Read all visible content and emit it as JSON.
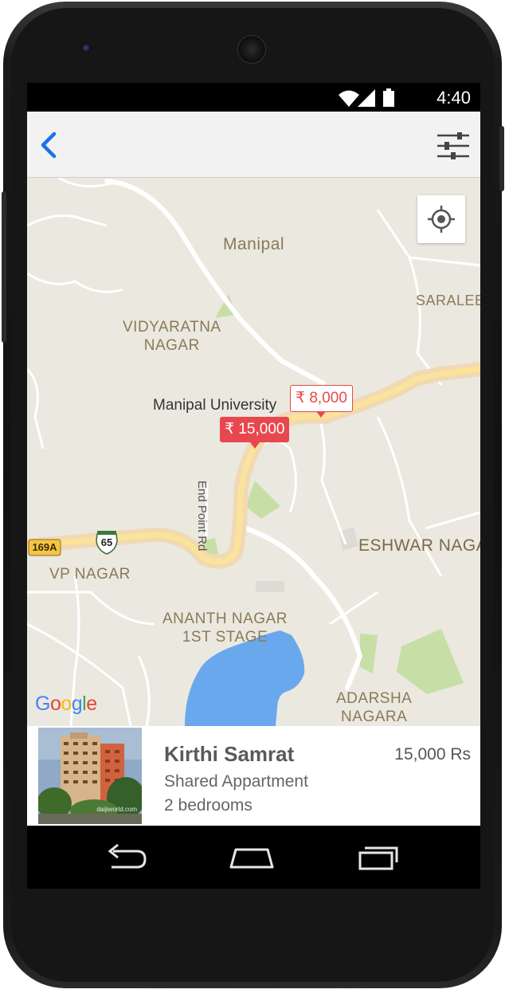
{
  "status_bar": {
    "time": "4:40"
  },
  "map": {
    "labels": {
      "manipal": "Manipal",
      "saralebettu": "SARALEB",
      "vidyaratna": "VIDYARATNA\nNAGAR",
      "manipal_university": "Manipal University",
      "eshwar_nagar": "ESHWAR NAGA",
      "vp_nagar": "VP NAGAR",
      "ananth_nagar": "ANANTH NAGAR\n1ST STAGE",
      "adarsha_nagara": "ADARSHA\nNAGARA",
      "end_point_rd": "End Point Rd",
      "route_169a": "169A",
      "route_65": "65"
    },
    "markers": [
      {
        "price": "₹ 8,000",
        "selected": false
      },
      {
        "price": "₹ 15,000",
        "selected": true
      }
    ],
    "attribution": "Google"
  },
  "listing": {
    "title": "Kirthi Samrat",
    "price": "15,000 Rs",
    "type": "Shared Appartment",
    "bedrooms": "2 bedrooms",
    "photo_watermark": "daijiworld.com"
  },
  "colors": {
    "accent": "#1a73e8",
    "marker_red": "#e8474f",
    "map_land": "#ebe8df",
    "map_water": "#6aa8ee",
    "map_park": "#c7dfa6",
    "map_highway": "#fbe39a"
  }
}
